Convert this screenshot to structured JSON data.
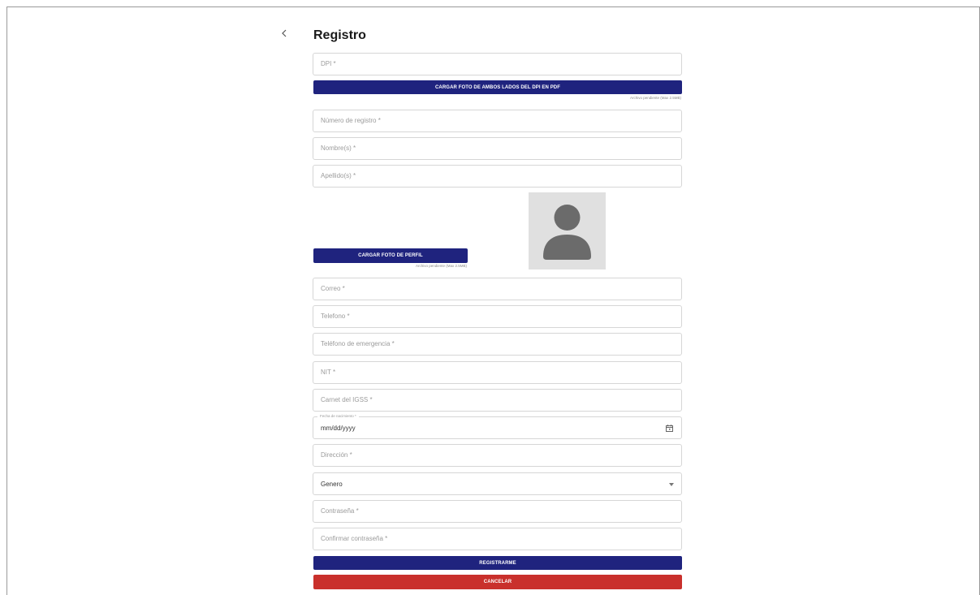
{
  "page": {
    "title": "Registro"
  },
  "fields": {
    "dpi": "DPI *",
    "numero_registro": "Número de registro *",
    "nombres": "Nombre(s) *",
    "apellidos": "Apellido(s) *",
    "correo": "Correo *",
    "telefono": "Telefono *",
    "telefono_emergencia": "Teléfono de emergencia *",
    "nit": "NIT *",
    "carnet_igss": "Carnet del IGSS *",
    "fecha_nacimiento_label": "Fecha de nacimiento *",
    "fecha_nacimiento_value": "mm/dd/yyyy",
    "direccion": "Dirección *",
    "genero": "Genero",
    "contrasena": "Contraseña *",
    "confirmar_contrasena": "Confirmar contraseña *"
  },
  "buttons": {
    "upload_dpi": "CARGAR FOTO DE AMBOS LADOS DEL DPI EN PDF",
    "upload_profile": "CARGAR FOTO DE PERFIL",
    "register": "REGISTRARME",
    "cancel": "CANCELAR"
  },
  "hints": {
    "dpi_file": "Archivo pendiente (Max 2.5MB)",
    "profile_file": "Archivo pendiente (Max 2.5MB)"
  },
  "icons": {
    "back": "chevron-left-icon",
    "avatar": "user-silhouette-icon",
    "calendar": "calendar-icon",
    "select": "caret-down-icon"
  },
  "colors": {
    "primary": "#1f237e",
    "danger": "#c9302c",
    "avatar_bg": "#e0e0e0",
    "avatar_fg": "#6b6b6b"
  }
}
